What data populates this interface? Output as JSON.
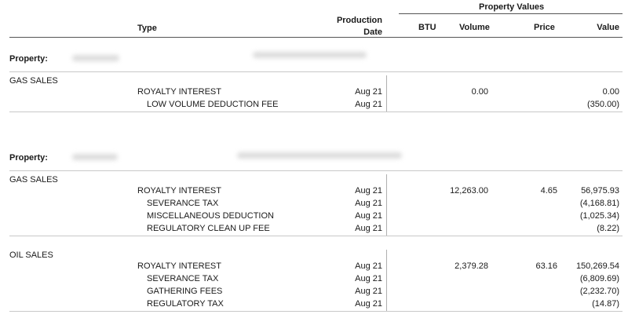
{
  "header": {
    "type": "Type",
    "production_line1": "Production",
    "production_line2": "Date",
    "property_values": "Property Values",
    "btu": "BTU",
    "volume": "Volume",
    "price": "Price",
    "value": "Value"
  },
  "sections": [
    {
      "property_label": "Property:",
      "groups": [
        {
          "category": "GAS SALES",
          "rows": [
            {
              "type": "ROYALTY INTEREST",
              "date": "Aug 21",
              "btu": "",
              "volume": "0.00",
              "price": "",
              "value": "0.00"
            },
            {
              "type": "LOW VOLUME DEDUCTION FEE",
              "date": "Aug 21",
              "btu": "",
              "volume": "",
              "price": "",
              "value": "(350.00)"
            }
          ]
        }
      ]
    },
    {
      "property_label": "Property:",
      "groups": [
        {
          "category": "GAS SALES",
          "rows": [
            {
              "type": "ROYALTY INTEREST",
              "date": "Aug 21",
              "btu": "",
              "volume": "12,263.00",
              "price": "4.65",
              "value": "56,975.93"
            },
            {
              "type": "SEVERANCE TAX",
              "date": "Aug 21",
              "btu": "",
              "volume": "",
              "price": "",
              "value": "(4,168.81)"
            },
            {
              "type": "MISCELLANEOUS DEDUCTION",
              "date": "Aug 21",
              "btu": "",
              "volume": "",
              "price": "",
              "value": "(1,025.34)"
            },
            {
              "type": "REGULATORY CLEAN UP FEE",
              "date": "Aug 21",
              "btu": "",
              "volume": "",
              "price": "",
              "value": "(8.22)"
            }
          ]
        },
        {
          "category": "OIL SALES",
          "rows": [
            {
              "type": "ROYALTY INTEREST",
              "date": "Aug 21",
              "btu": "",
              "volume": "2,379.28",
              "price": "63.16",
              "value": "150,269.54"
            },
            {
              "type": "SEVERANCE TAX",
              "date": "Aug 21",
              "btu": "",
              "volume": "",
              "price": "",
              "value": "(6,809.69)"
            },
            {
              "type": "GATHERING FEES",
              "date": "Aug 21",
              "btu": "",
              "volume": "",
              "price": "",
              "value": "(2,232.70)"
            },
            {
              "type": "REGULATORY TAX",
              "date": "Aug 21",
              "btu": "",
              "volume": "",
              "price": "",
              "value": "(14.87)"
            }
          ]
        }
      ]
    }
  ]
}
